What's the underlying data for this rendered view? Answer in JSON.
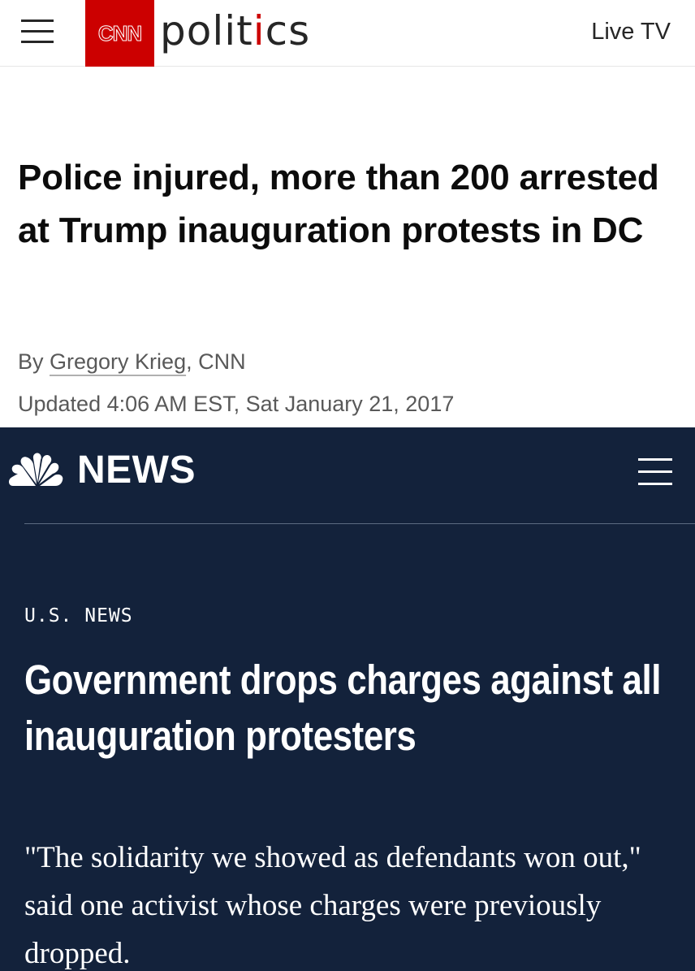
{
  "cnn": {
    "logo_text": "CNN",
    "section_word_main": "polit",
    "section_word_accent": "i",
    "section_word_end": "cs",
    "live_tv": "Live TV",
    "headline": "Police injured, more than 200 arrested at Trump inauguration protests in DC",
    "byline_prefix": "By ",
    "author": "Gregory Krieg",
    "byline_suffix": ", CNN",
    "updated": "Updated 4:06 AM EST, Sat January 21, 2017",
    "colors": {
      "brand_red": "#cc0000",
      "text": "#0c0c0c",
      "meta": "#595959"
    }
  },
  "nbc": {
    "logo_word": "NEWS",
    "section_label": "U.S. NEWS",
    "headline": "Government drops charges against all inauguration protesters",
    "dek": "\"The solidarity we showed as defendants won out,\" said one activist whose charges were previously dropped.",
    "colors": {
      "background": "#13223b",
      "text": "#ffffff"
    },
    "icons": [
      "peacock-logo-icon",
      "hamburger-menu-icon"
    ]
  }
}
